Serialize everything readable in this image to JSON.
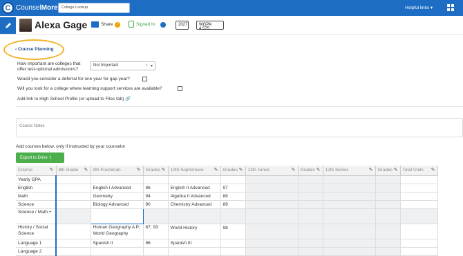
{
  "header": {
    "brand_prefix": "Counsel",
    "brand_suffix": "More",
    "search_value": "College Lookup",
    "helpful_links": "Helpful links ▾"
  },
  "student": {
    "name": "Alexa Gage",
    "share_label": "Share",
    "share_count": "!",
    "signed_in": "Signed In",
    "year": "2027",
    "wgpa": "WGPA: 4.575"
  },
  "nav": {
    "back_label": "‹  Course Planning"
  },
  "questions": {
    "test_optional": "How important are colleges that offer test-optional admissions?",
    "test_optional_value": "Not Important",
    "deferral": "Would you consider a deferral for one year for gap year?",
    "learning_support": "Will you look for a college where learning support services are available?",
    "hs_profile": "Add link to High School Profile (or upload to Files tab)"
  },
  "notes": {
    "placeholder": "Course Notes"
  },
  "courses": {
    "intro": "Add courses below, only if instructed by your counselor",
    "export_label": "Export to Drive",
    "columns": [
      "Course",
      "8th Grade",
      "9th Freshman",
      "Grades",
      "10th Sophomore",
      "Grades",
      "11th Junior",
      "Grades",
      "12th Senior",
      "Grades",
      "Total Units"
    ],
    "rows": [
      [
        "Yearly GPA",
        "",
        "",
        "",
        "",
        "",
        "",
        "",
        "",
        "",
        ""
      ],
      [
        "English",
        "",
        "English I Advanced",
        "96",
        "English II Advanced",
        "97",
        "",
        "",
        "",
        "",
        ""
      ],
      [
        "Math",
        "",
        "Geometry",
        "94",
        "Algebra II Advanced",
        "88",
        "",
        "",
        "",
        "",
        ""
      ],
      [
        "Science",
        "",
        "Biology Advanced",
        "90",
        "Chemistry Advanced",
        "89",
        "",
        "",
        "",
        "",
        ""
      ],
      [
        "Science / Math +",
        "",
        "",
        "",
        "",
        "",
        "",
        "",
        "",
        "",
        ""
      ],
      [
        "History / Social Science",
        "",
        "Human Geography A P; World Geography",
        "87; 93",
        "World History",
        "98",
        "",
        "",
        "",
        "",
        ""
      ],
      [
        "Language 1",
        "",
        "Spanish II",
        "96",
        "Spanish III",
        "",
        "",
        "",
        "",
        "",
        ""
      ],
      [
        "Language 2",
        "",
        "",
        "",
        "",
        "",
        "",
        "",
        "",
        "",
        ""
      ]
    ]
  }
}
